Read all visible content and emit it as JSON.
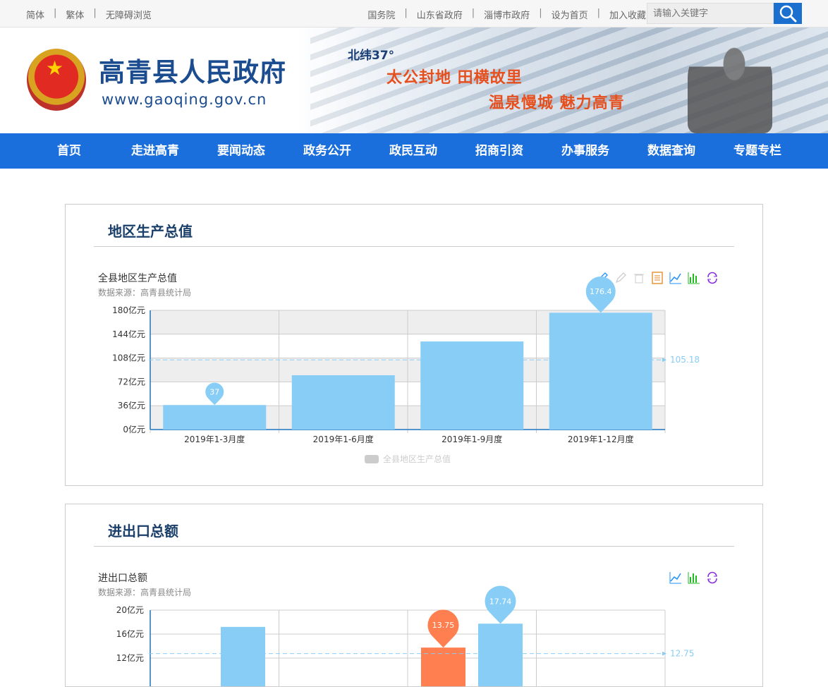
{
  "topbar": {
    "lang_links": [
      "简体",
      "繁体",
      "无障碍浏览"
    ],
    "links": [
      "国务院",
      "山东省政府",
      "淄博市政府",
      "设为首页",
      "加入收藏"
    ],
    "search_placeholder": "请输入关键字"
  },
  "banner": {
    "site_title": "高青县人民政府",
    "site_url": "www.gaoqing.gov.cn",
    "latitude": "北纬37°",
    "slogan_1": "太公封地 田横故里",
    "slogan_2": "温泉慢城 魅力高青"
  },
  "nav": [
    "首页",
    "走进高青",
    "要闻动态",
    "政务公开",
    "政民互动",
    "招商引资",
    "办事服务",
    "数据查询",
    "专题专栏"
  ],
  "sections": {
    "gdp_heading": "地区生产总值",
    "trade_heading": "进出口总额"
  },
  "chart_data": [
    {
      "type": "bar",
      "title": "全县地区生产总值",
      "subtitle": "数据来源：高青县统计局",
      "categories": [
        "2019年1-3月度",
        "2019年1-6月度",
        "2019年1-9月度",
        "2019年1-12月度"
      ],
      "series": [
        {
          "name": "全县地区生产总值",
          "values": [
            37,
            82,
            133,
            176.4
          ]
        }
      ],
      "y_ticks": [
        "0亿元",
        "36亿元",
        "72亿元",
        "108亿元",
        "144亿元",
        "180亿元"
      ],
      "ylim": [
        0,
        180
      ],
      "mark_points": [
        {
          "index": 0,
          "label": "37"
        },
        {
          "index": 3,
          "label": "176.4"
        }
      ],
      "average_line": {
        "value": 105.18,
        "label": "105.18"
      },
      "colors": {
        "bar": "#88cdf6",
        "pin": "#88cdf6",
        "avg": "#88cdf6",
        "band": "#eeeeee"
      },
      "legend": "bottom-center",
      "toolbox_icons": [
        "edit-icon",
        "edit-disabled-icon",
        "delete-icon",
        "data-view-icon",
        "line-chart-icon",
        "bar-chart-icon",
        "refresh-icon"
      ]
    },
    {
      "type": "bar",
      "title": "进出口总额",
      "subtitle": "数据来源：高青县统计局",
      "y_ticks": [
        "12亿元",
        "16亿元",
        "20亿元"
      ],
      "ylim": [
        0,
        20
      ],
      "bars": [
        {
          "slot": 0,
          "value": 17.2,
          "color": "#88cdf6"
        },
        {
          "slot": 2,
          "value": 13.75,
          "color": "#ff7f50"
        },
        {
          "slot": 3,
          "value": 17.74,
          "color": "#88cdf6"
        }
      ],
      "mark_points": [
        {
          "bar": 1,
          "label": "13.75",
          "color": "#ff7f50"
        },
        {
          "bar": 2,
          "label": "17.74",
          "color": "#88cdf6"
        }
      ],
      "average_line": {
        "value": 12.75,
        "label": "12.75"
      },
      "toolbox_icons": [
        "line-chart-icon",
        "bar-chart-icon",
        "refresh-icon"
      ]
    }
  ]
}
